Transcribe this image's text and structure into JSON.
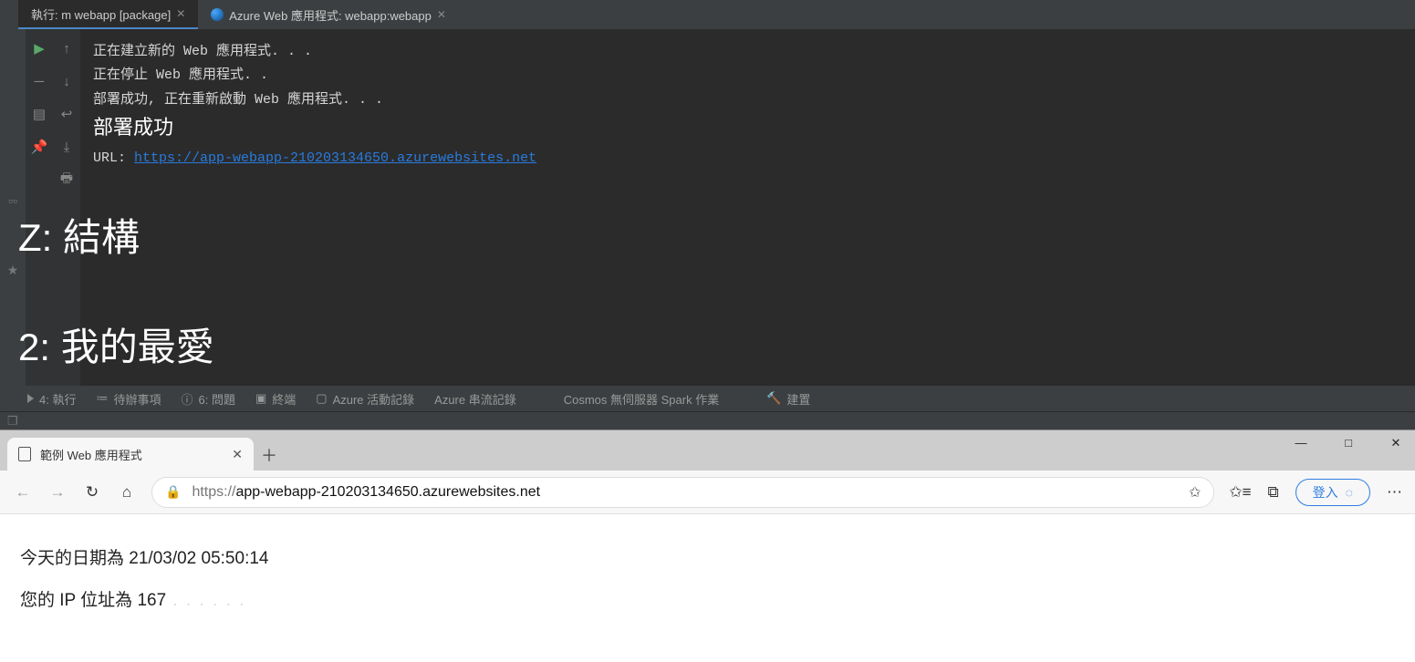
{
  "ide": {
    "tabs": [
      {
        "label": "執行: m webapp [package]",
        "active": true
      },
      {
        "label": "Azure  Web 應用程式: webapp:webapp",
        "active": false,
        "icon": "globe"
      }
    ],
    "console": {
      "lines": [
        "正在建立新的 Web 應用程式. . .",
        "正在停止 Web 應用程式. .",
        "部署成功, 正在重新啟動 Web  應用程式. . ."
      ],
      "success_line": "部署成功",
      "url_label": "URL: ",
      "url": "https://app-webapp-210203134650.azurewebsites.net"
    },
    "overlays": {
      "structure": "Z: 結構",
      "favorites": "2: 我的最愛"
    },
    "bottom_toolbar": {
      "run": "4: 執行",
      "todo": "待辦事項",
      "problems": "6: 問題",
      "terminal": "終端",
      "azure_activity": "Azure 活動記錄",
      "azure_stream": "Azure 串流記錄",
      "cosmos": "Cosmos 無伺服器 Spark 作業",
      "build": "建置"
    }
  },
  "browser": {
    "tab_title": "範例 Web 應用程式",
    "url_scheme": "https://",
    "url_host": "app-webapp-210203134650.azurewebsites.net",
    "signin": "登入",
    "page": {
      "date_line": "今天的日期為 21/03/02 05:50:14",
      "ip_prefix": "您的 IP 位址為 167",
      "ip_redacted": " . . . . . ."
    }
  }
}
